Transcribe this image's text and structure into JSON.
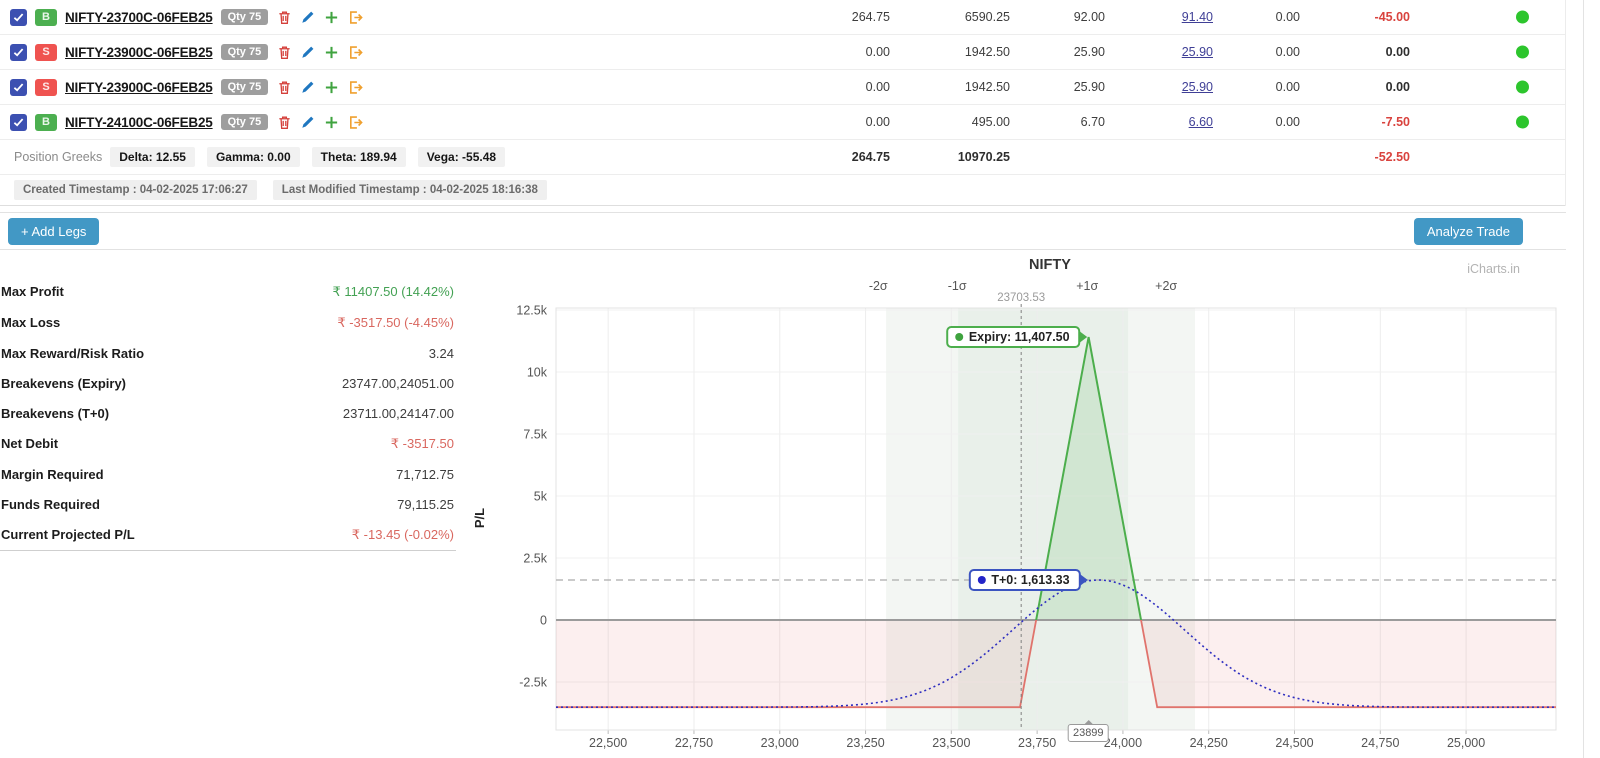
{
  "colors": {
    "accent": "#4298c5",
    "buy_green": "#4caf50",
    "sell_red": "#ef5350",
    "status_dot": "#2dc52d",
    "profit_green": "#43a153",
    "loss_red": "#d9675f"
  },
  "legs_table": {
    "row_icons": [
      "delete",
      "edit",
      "add",
      "exit"
    ],
    "qty_label": "Qty 75",
    "rows": [
      {
        "checked": true,
        "side": "B",
        "name": "NIFTY-23700C-06FEB25",
        "qty": "Qty 75",
        "values": [
          "264.75",
          "6590.25",
          "92.00",
          "91.40",
          "0.00",
          "-45.00"
        ],
        "status": "green"
      },
      {
        "checked": true,
        "side": "S",
        "name": "NIFTY-23900C-06FEB25",
        "qty": "Qty 75",
        "values": [
          "0.00",
          "1942.50",
          "25.90",
          "25.90",
          "0.00",
          "0.00"
        ],
        "status": "green"
      },
      {
        "checked": true,
        "side": "S",
        "name": "NIFTY-23900C-06FEB25",
        "qty": "Qty 75",
        "values": [
          "0.00",
          "1942.50",
          "25.90",
          "25.90",
          "0.00",
          "0.00"
        ],
        "status": "green"
      },
      {
        "checked": true,
        "side": "B",
        "name": "NIFTY-24100C-06FEB25",
        "qty": "Qty 75",
        "values": [
          "0.00",
          "495.00",
          "6.70",
          "6.60",
          "0.00",
          "-7.50"
        ],
        "status": "green"
      }
    ],
    "greeks": {
      "label": "Position Greeks",
      "items": [
        "Delta: 12.55",
        "Gamma: 0.00",
        "Theta: 189.94",
        "Vega: -55.48"
      ]
    },
    "totals": [
      "264.75",
      "10970.25",
      "",
      "",
      "",
      "-52.50"
    ],
    "timestamps": [
      "Created Timestamp : 04-02-2025 17:06:27",
      "Last Modified Timestamp : 04-02-2025 18:16:38"
    ]
  },
  "toolbar": {
    "add_legs": "+ Add Legs",
    "analyze": "Analyze Trade"
  },
  "stats": [
    {
      "label": "Max Profit",
      "value": "₹ 11407.50 (14.42%)",
      "color": "green"
    },
    {
      "label": "Max Loss",
      "value": "₹ -3517.50 (-4.45%)",
      "color": "red"
    },
    {
      "label": "Max Reward/Risk Ratio",
      "value": "3.24",
      "color": "dark"
    },
    {
      "label": "Breakevens (Expiry)",
      "value": "23747.00,24051.00",
      "color": "dark"
    },
    {
      "label": "Breakevens (T+0)",
      "value": "23711.00,24147.00",
      "color": "dark"
    },
    {
      "label": "Net Debit",
      "value": "₹ -3517.50",
      "color": "red"
    },
    {
      "label": "Margin Required",
      "value": "71,712.75",
      "color": "dark"
    },
    {
      "label": "Funds Required",
      "value": "79,115.25",
      "color": "dark"
    },
    {
      "label": "Current Projected P/L",
      "value": "₹ -13.45 (-0.02%)",
      "color": "red"
    }
  ],
  "chart_data": {
    "type": "line",
    "title": "NIFTY",
    "watermark": "iCharts.in",
    "ylabel": "P/L",
    "xlim": [
      22348,
      25262
    ],
    "ylim": [
      -4435,
      12580
    ],
    "x_ticks": [
      {
        "value": 22500,
        "label": "22,500"
      },
      {
        "value": 22750,
        "label": "22,750"
      },
      {
        "value": 23000,
        "label": "23,000"
      },
      {
        "value": 23250,
        "label": "23,250"
      },
      {
        "value": 23500,
        "label": "23,500"
      },
      {
        "value": 23750,
        "label": "23,750"
      },
      {
        "value": 24000,
        "label": "24,000"
      },
      {
        "value": 24250,
        "label": "24,250"
      },
      {
        "value": 24500,
        "label": "24,500"
      },
      {
        "value": 24750,
        "label": "24,750"
      },
      {
        "value": 25000,
        "label": "25,000"
      }
    ],
    "y_ticks": [
      {
        "value": 12500,
        "label": "12.5k"
      },
      {
        "value": 10000,
        "label": "10k"
      },
      {
        "value": 7500,
        "label": "7.5k"
      },
      {
        "value": 5000,
        "label": "5k"
      },
      {
        "value": 2500,
        "label": "2.5k"
      },
      {
        "value": 0,
        "label": "0"
      },
      {
        "value": -2500,
        "label": "-2.5k"
      }
    ],
    "current_price": {
      "value": 23703.53,
      "label": "23703.53"
    },
    "sigma_markers": [
      {
        "label": "-2σ",
        "price": 23287
      },
      {
        "label": "-1σ",
        "price": 23517
      },
      {
        "label": "+1σ",
        "price": 23896
      },
      {
        "label": "+2σ",
        "price": 24126
      }
    ],
    "sigma_bands": {
      "outer": [
        23310,
        24210
      ],
      "inner": [
        23520,
        24015
      ]
    },
    "expiry_payoff": {
      "name": "Expiry",
      "label": "Expiry: 11,407.50",
      "max_profit": 11407.5,
      "max_loss": -3517.5,
      "peak_price": 23900,
      "breakevens": [
        23747,
        24051
      ],
      "color": "#4cae4c",
      "neg_color": "#e0736c",
      "points": [
        [
          22348,
          -3517.5
        ],
        [
          23700,
          -3517.5
        ],
        [
          23900,
          11407.5
        ],
        [
          24100,
          -3517.5
        ],
        [
          25262,
          -3517.5
        ]
      ]
    },
    "t0_curve": {
      "name": "T+0",
      "label": "T+0: 1,613.33",
      "level": 1613.33,
      "breakevens": [
        23711,
        24147
      ],
      "color": "#2e2ec0",
      "model": "gaussian",
      "base": -3517.5,
      "amplitude": 5131,
      "center": 23929,
      "sigma": 355
    },
    "crosshair": {
      "price": 23899,
      "label": "23899"
    }
  }
}
